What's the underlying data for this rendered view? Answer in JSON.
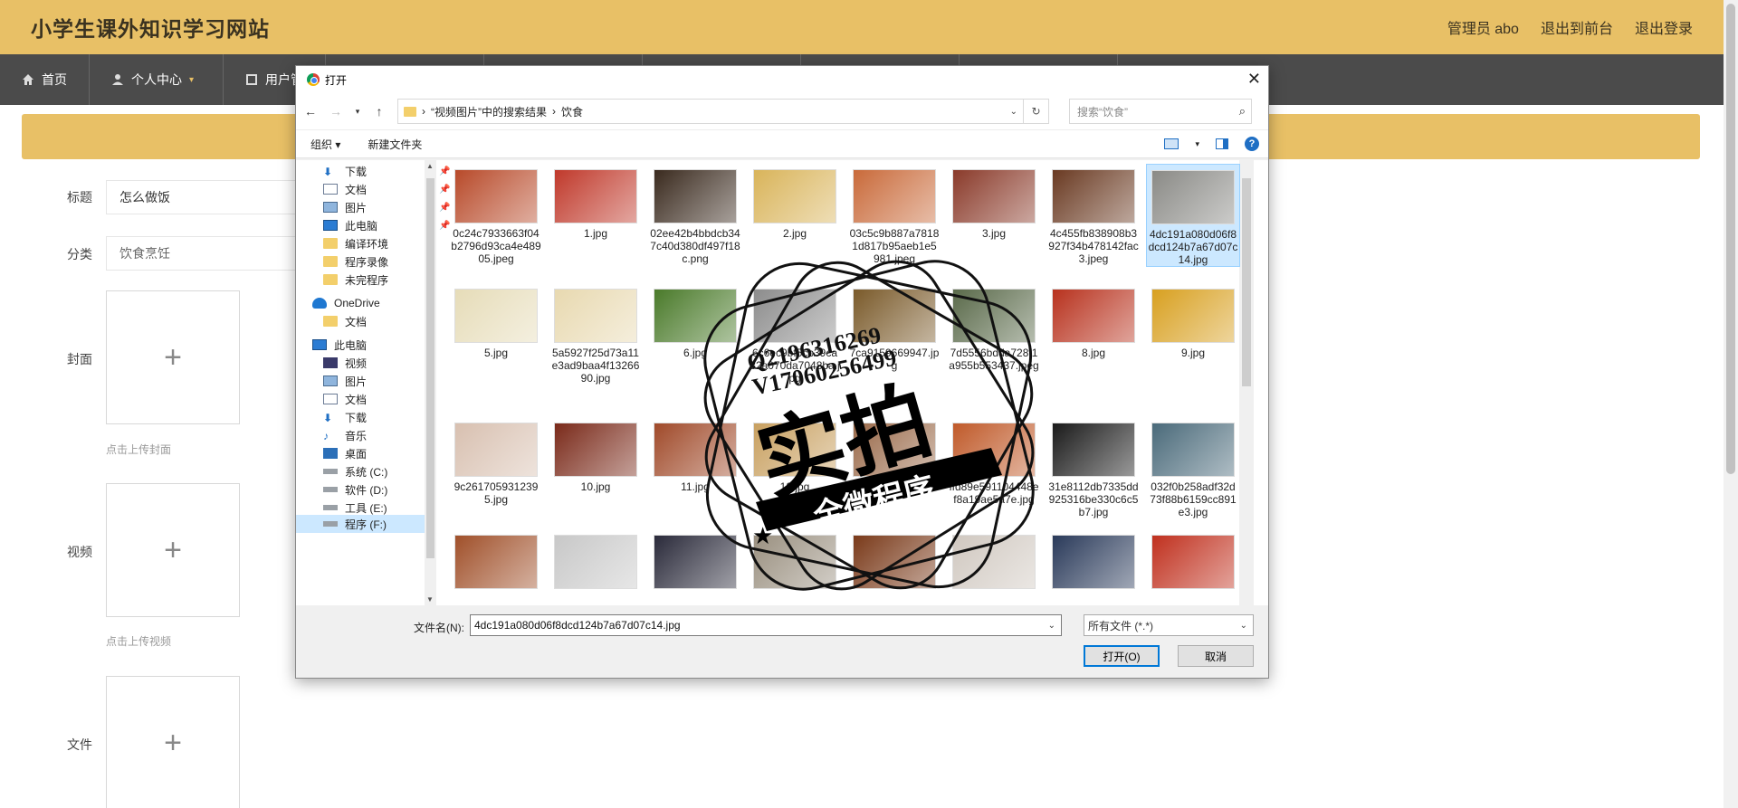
{
  "site": {
    "title": "小学生课外知识学习网站",
    "admin": "管理员 abo",
    "back_front": "退出到前台",
    "logout": "退出登录"
  },
  "nav": {
    "home": "首页",
    "personal": "个人中心",
    "user": "用户管"
  },
  "form": {
    "title_label": "标题",
    "title_value": "怎么做饭",
    "category_label": "分类",
    "category_value": "饮食烹饪",
    "cover_label": "封面",
    "cover_hint": "点击上传封面",
    "video_label": "视频",
    "video_hint": "点击上传视频",
    "file_label": "文件",
    "plus": "+"
  },
  "dialog": {
    "title": "打开",
    "path_part1": "“视频图片”中的搜索结果",
    "path_sep": "›",
    "path_part2": "饮食",
    "search_placeholder": "搜索“饮食”",
    "organize": "组织 ▾",
    "new_folder": "新建文件夹",
    "help": "?",
    "filename_label": "文件名(N):",
    "filename_value": "4dc191a080d06f8dcd124b7a67d07c14.jpg",
    "filetype": "所有文件 (*.*)",
    "open_btn": "打开(O)",
    "cancel_btn": "取消"
  },
  "tree": [
    {
      "label": "下载",
      "icon": "download-icon",
      "pin": true
    },
    {
      "label": "文档",
      "icon": "document-icon",
      "pin": true
    },
    {
      "label": "图片",
      "icon": "picture-icon",
      "pin": true
    },
    {
      "label": "此电脑",
      "icon": "computer-icon",
      "pin": true
    },
    {
      "label": "编译环境",
      "icon": "folder-icon",
      "pin": false
    },
    {
      "label": "程序录像",
      "icon": "folder-icon",
      "pin": false
    },
    {
      "label": "未完程序",
      "icon": "folder-icon",
      "pin": false
    },
    {
      "label": "OneDrive",
      "icon": "cloud-icon",
      "pin": false
    },
    {
      "label": "文档",
      "icon": "folder-icon",
      "pin": false
    },
    {
      "label": "此电脑",
      "icon": "computer-icon",
      "pin": false
    },
    {
      "label": "视频",
      "icon": "video-icon",
      "pin": false
    },
    {
      "label": "图片",
      "icon": "picture-icon",
      "pin": false
    },
    {
      "label": "文档",
      "icon": "document-icon",
      "pin": false
    },
    {
      "label": "下载",
      "icon": "download-icon",
      "pin": false
    },
    {
      "label": "音乐",
      "icon": "music-icon",
      "pin": false
    },
    {
      "label": "桌面",
      "icon": "desktop-icon",
      "pin": false
    },
    {
      "label": "系统 (C:)",
      "icon": "drive-icon",
      "pin": false
    },
    {
      "label": "软件 (D:)",
      "icon": "drive-icon",
      "pin": false
    },
    {
      "label": "工具 (E:)",
      "icon": "drive-icon",
      "pin": false
    },
    {
      "label": "程序 (F:)",
      "icon": "drive-icon",
      "pin": false
    }
  ],
  "files": [
    {
      "name": "0c24c7933663f04b2796d93ca4e48905.jpeg",
      "color": "#b84a2a"
    },
    {
      "name": "1.jpg",
      "color": "#c0392b"
    },
    {
      "name": "02ee42b4bbdcb347c40d380df497f18c.png",
      "color": "#3a2a1e"
    },
    {
      "name": "2.jpg",
      "color": "#d9b45a"
    },
    {
      "name": "03c5c9b887a78181d817b95aeb1e5981.jpeg",
      "color": "#c96a3a"
    },
    {
      "name": "3.jpg",
      "color": "#8a3a2a"
    },
    {
      "name": "4c455fb838908b3927f34b478142fac3.jpeg",
      "color": "#6a3a22"
    },
    {
      "name": "4dc191a080d06f8dcd124b7a67d07c14.jpg",
      "color": "#8a8a86"
    },
    {
      "name": "5.jpg",
      "color": "#e6dcb8"
    },
    {
      "name": "5a5927f25d73a11e3ad9baa4f1326690.jpg",
      "color": "#e8d9b0"
    },
    {
      "name": "6.jpg",
      "color": "#4a7a2a"
    },
    {
      "name": "6c6ec9bf5cb39ca82a070da7048ba.jpg",
      "color": "#8c8c8c"
    },
    {
      "name": "7ca9159669947.jpg",
      "color": "#7a5a2a"
    },
    {
      "name": "7d5556bdda728f1a955b553437.jpeg",
      "color": "#5a6a4a"
    },
    {
      "name": "8.jpg",
      "color": "#b8321e"
    },
    {
      "name": "9.jpg",
      "color": "#d8a020"
    },
    {
      "name": "9c2617059312395.jpg",
      "color": "#d8c0b0"
    },
    {
      "name": "10.jpg",
      "color": "#7a2a1a"
    },
    {
      "name": "11.jpg",
      "color": "#a04a2a"
    },
    {
      "name": "12.jpg",
      "color": "#c8a060"
    },
    {
      "name": "",
      "color": "#9a6a4a"
    },
    {
      "name": "ffd89e591104448ef8a19ae5a7e.jpg",
      "color": "#c05a2a"
    },
    {
      "name": "31e8112db7335dd925316be330c6c5b7.jpg",
      "color": "#1a1a1a"
    },
    {
      "name": "032f0b258adf32d73f88b6159cc891e3.jpg",
      "color": "#4a6a7a"
    },
    {
      "name": "",
      "color": "#a0502a"
    },
    {
      "name": "",
      "color": "#c8c8c8"
    },
    {
      "name": "",
      "color": "#2a2a3a"
    },
    {
      "name": "",
      "color": "#9a9080"
    },
    {
      "name": "",
      "color": "#7a3a1a"
    },
    {
      "name": "",
      "color": "#d0c8c0"
    },
    {
      "name": "",
      "color": "#2a3a5a"
    },
    {
      "name": "",
      "color": "#c0301e"
    }
  ],
  "stamp": {
    "line1": "Q2196316269",
    "line2": "V17060256499",
    "main": "实拍",
    "ribbon": "全微程序"
  },
  "colors": {
    "accent": "#e8c066",
    "nav_bg": "#4b4b4b",
    "selection": "#cce8ff"
  }
}
